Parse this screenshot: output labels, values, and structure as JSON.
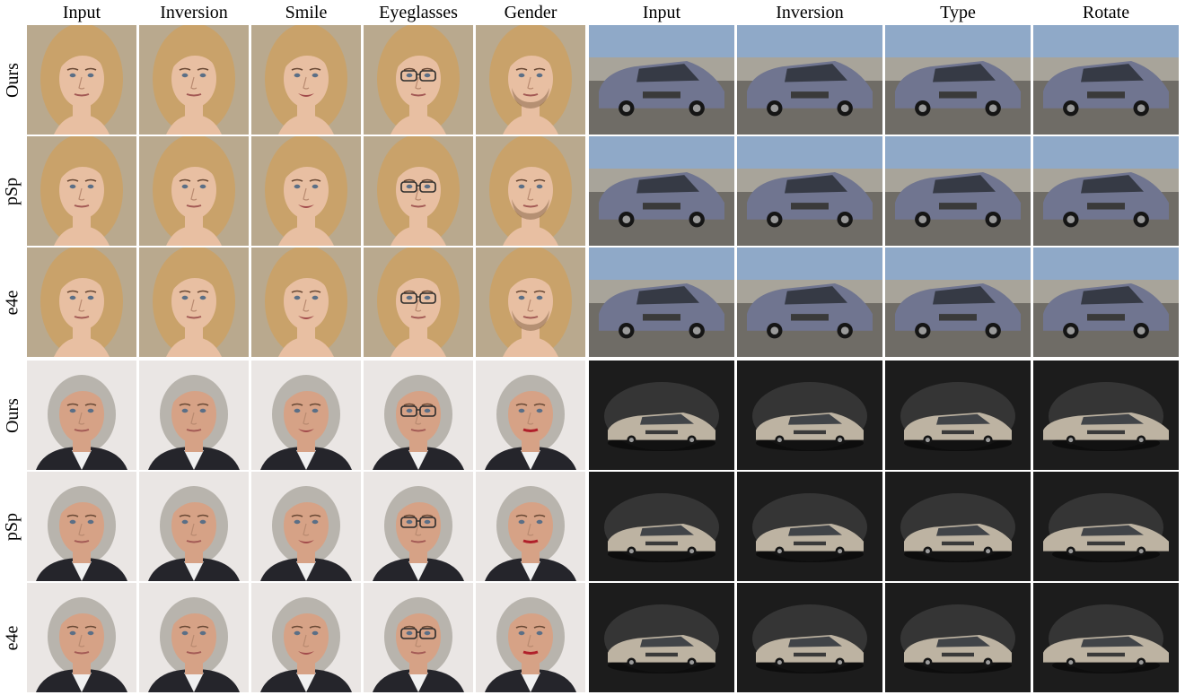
{
  "columns": [
    {
      "id": "face-input",
      "label": "Input"
    },
    {
      "id": "face-inversion",
      "label": "Inversion"
    },
    {
      "id": "face-smile",
      "label": "Smile"
    },
    {
      "id": "face-eyeglasses",
      "label": "Eyeglasses"
    },
    {
      "id": "face-gender",
      "label": "Gender"
    },
    {
      "id": "car-input",
      "label": "Input"
    },
    {
      "id": "car-inversion",
      "label": "Inversion"
    },
    {
      "id": "car-type",
      "label": "Type"
    },
    {
      "id": "car-rotate",
      "label": "Rotate"
    }
  ],
  "rows": [
    {
      "label": "Ours"
    },
    {
      "label": "pSp"
    },
    {
      "label": "e4e"
    },
    {
      "label": "Ours"
    },
    {
      "label": "pSp"
    },
    {
      "label": "e4e"
    }
  ],
  "subjects": {
    "face_1": {
      "hair": "#c9a26a",
      "skin": "#e8bfa2",
      "background": "#b9a98e"
    },
    "face_2": {
      "hair": "#b8b4ad",
      "skin": "#d6a286",
      "background": "#eae6e4",
      "suit": "#25252b"
    },
    "car_1": {
      "body": "#707590",
      "sky": "#8fa9c8",
      "ground": "#6f6c66"
    },
    "car_2": {
      "body": "#bdb3a2",
      "backdrop": "#1c1c1c"
    }
  }
}
